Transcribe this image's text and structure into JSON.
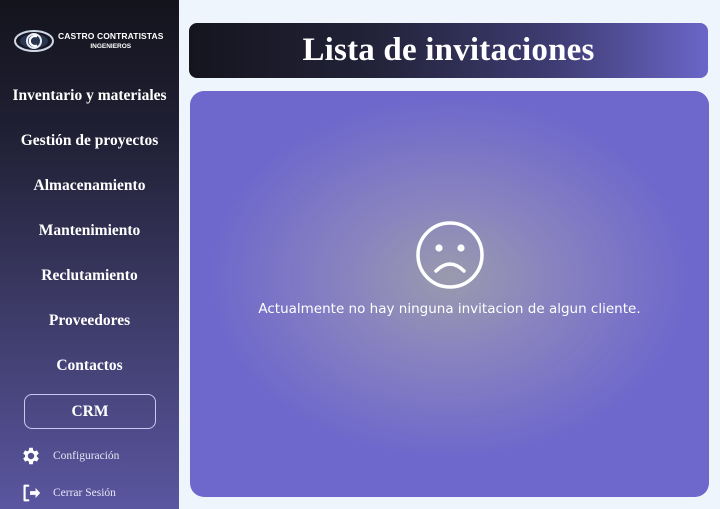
{
  "brand": {
    "name": "CASTRO CONTRATISTAS",
    "sub": "INGENIEROS"
  },
  "sidebar": {
    "items": [
      {
        "label": "Inventario y materiales"
      },
      {
        "label": "Gestión de proyectos"
      },
      {
        "label": "Almacenamiento"
      },
      {
        "label": "Mantenimiento"
      },
      {
        "label": "Reclutamiento"
      },
      {
        "label": "Proveedores"
      },
      {
        "label": "Contactos"
      },
      {
        "label": "CRM",
        "active": true
      }
    ],
    "settings_label": "Configuración",
    "logout_label": "Cerrar Sesión"
  },
  "header": {
    "title": "Lista de invitaciones"
  },
  "main": {
    "empty_icon": "sad-face-icon",
    "empty_message": "Actualmente no hay ninguna invitacion de algun cliente."
  },
  "colors": {
    "page_bg": "#eef5fd",
    "panel": "#6e68cc",
    "sidebar_dark": "#14141d"
  }
}
